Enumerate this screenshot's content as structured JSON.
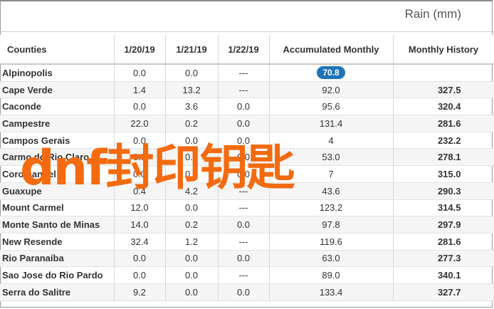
{
  "header": {
    "rain_label": "Rain (mm)"
  },
  "columns": [
    "Counties",
    "1/20/19",
    "1/21/19",
    "1/22/19",
    "Accumulated Monthly",
    "Monthly History"
  ],
  "rows": [
    {
      "county": "Alpinopolis",
      "d1": "0.0",
      "d2": "0.0",
      "d3": "---",
      "acc": "70.8",
      "hist": "",
      "highlight": true
    },
    {
      "county": "Cape Verde",
      "d1": "1.4",
      "d2": "13.2",
      "d3": "---",
      "acc": "92.0",
      "hist": "327.5"
    },
    {
      "county": "Caconde",
      "d1": "0.0",
      "d2": "3.6",
      "d3": "0.0",
      "acc": "95.6",
      "hist": "320.4"
    },
    {
      "county": "Campestre",
      "d1": "22.0",
      "d2": "0.2",
      "d3": "0.0",
      "acc": "131.4",
      "hist": "281.6"
    },
    {
      "county": "Campos Gerais",
      "d1": "0.0",
      "d2": "0.0",
      "d3": "0.0",
      "acc": "4",
      "hist": "232.2"
    },
    {
      "county": "Carmo do Rio Claro",
      "d1": "0.0",
      "d2": "0.0",
      "d3": "0.0",
      "acc": "53.0",
      "hist": "278.1"
    },
    {
      "county": "Coromandel",
      "d1": "0.0",
      "d2": "0.0",
      "d3": "0.0",
      "acc": "7",
      "hist": "315.0"
    },
    {
      "county": "Guaxupe",
      "d1": "0.4",
      "d2": "4.2",
      "d3": "---",
      "acc": "43.6",
      "hist": "290.3"
    },
    {
      "county": "Mount Carmel",
      "d1": "12.0",
      "d2": "0.0",
      "d3": "---",
      "acc": "123.2",
      "hist": "314.5"
    },
    {
      "county": "Monte Santo de Minas",
      "d1": "14.0",
      "d2": "0.2",
      "d3": "0.0",
      "acc": "97.8",
      "hist": "297.9"
    },
    {
      "county": "New Resende",
      "d1": "32.4",
      "d2": "1.2",
      "d3": "---",
      "acc": "119.6",
      "hist": "281.6"
    },
    {
      "county": "Rio Paranaíba",
      "d1": "0.0",
      "d2": "0.0",
      "d3": "0.0",
      "acc": "63.0",
      "hist": "277.3"
    },
    {
      "county": "Sao Jose do Rio Pardo",
      "d1": "0.0",
      "d2": "0.0",
      "d3": "---",
      "acc": "89.0",
      "hist": "340.1"
    },
    {
      "county": "Serra do Salitre",
      "d1": "9.2",
      "d2": "0.0",
      "d3": "0.0",
      "acc": "133.4",
      "hist": "327.7"
    }
  ],
  "watermark": "dnf封印钥匙",
  "colors": {
    "accent": "#1f74b8",
    "watermark": "#f26b10",
    "row_alt": "#f5f5f5"
  }
}
